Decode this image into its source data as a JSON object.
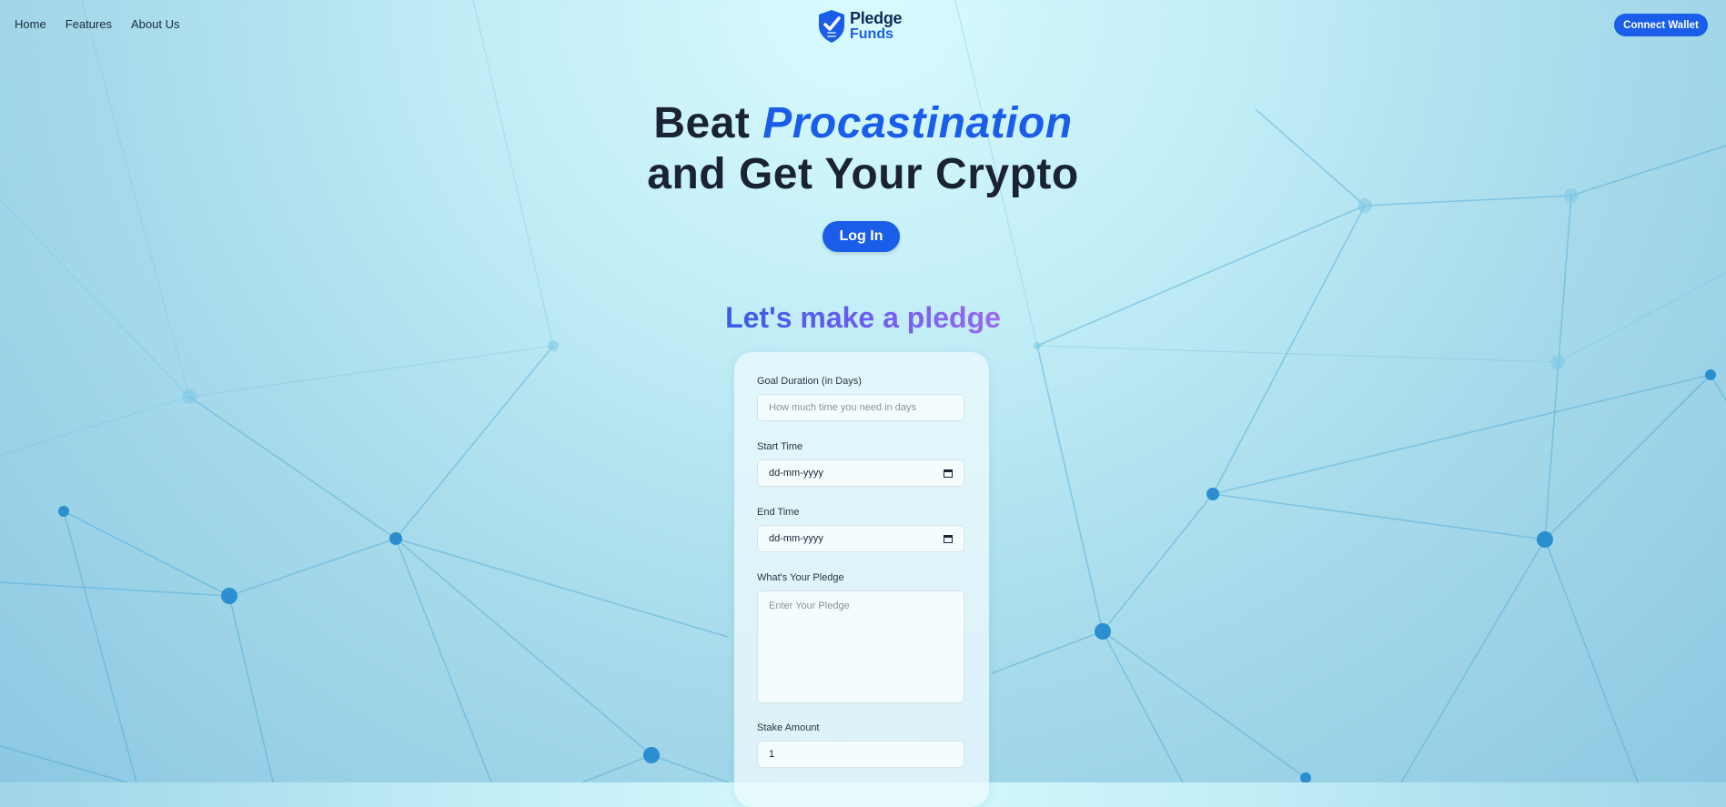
{
  "nav": {
    "links": [
      "Home",
      "Features",
      "About Us"
    ],
    "connect_label": "Connect Wallet"
  },
  "logo": {
    "line1": "Pledge",
    "line2": "Funds"
  },
  "hero": {
    "line1_prefix": "Beat",
    "line1_accent": "Procastination",
    "line2": "and Get Your Crypto",
    "login_label": "Log In"
  },
  "section_title": "Let's make a pledge",
  "form": {
    "duration": {
      "label": "Goal Duration (in Days)",
      "placeholder": "How much time you need in days"
    },
    "start": {
      "label": "Start Time",
      "value": "dd-mm-yyyy"
    },
    "end": {
      "label": "End Time",
      "value": "dd-mm-yyyy"
    },
    "pledge": {
      "label": "What's Your Pledge",
      "placeholder": "Enter Your Pledge"
    },
    "stake": {
      "label": "Stake Amount",
      "value": "1"
    }
  },
  "colors": {
    "accent": "#1a5de8",
    "heading": "#1a2334",
    "gradient_start": "#3a5ce8",
    "gradient_end": "#9b6af0"
  },
  "icons": [
    "shield-check-icon",
    "calendar-icon"
  ]
}
